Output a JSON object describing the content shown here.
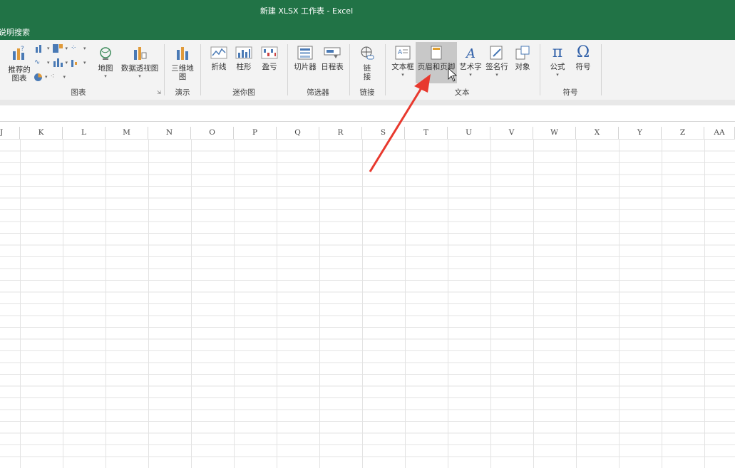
{
  "window": {
    "title": "新建 XLSX 工作表  -  Excel"
  },
  "tellme": {
    "text": "说明搜索"
  },
  "ribbon": {
    "buttons": {
      "recommended_charts": "推荐的\n图表",
      "map": "地图",
      "pivot_chart": "数据透视图",
      "map3d": "三维地\n图",
      "line": "折线",
      "column": "柱形",
      "winloss": "盈亏",
      "slicer": "切片器",
      "timeline": "日程表",
      "link": "链\n接",
      "textbox": "文本框",
      "header_footer": "页眉和页脚",
      "wordart": "艺术字",
      "signature": "签名行",
      "object": "对象",
      "equation": "公式",
      "symbol": "符号"
    },
    "groups": {
      "charts": "图表",
      "tours": "演示",
      "sparklines": "迷你图",
      "filters": "筛选器",
      "links": "链接",
      "text": "文本",
      "symbols": "符号"
    }
  },
  "columns": [
    "J",
    "K",
    "L",
    "M",
    "N",
    "O",
    "P",
    "Q",
    "R",
    "S",
    "T",
    "U",
    "V",
    "W",
    "X",
    "Y",
    "Z",
    "AA"
  ],
  "colors": {
    "accent": "#217346",
    "arrow": "#e8392e",
    "highlight": "#c8c8c8"
  }
}
